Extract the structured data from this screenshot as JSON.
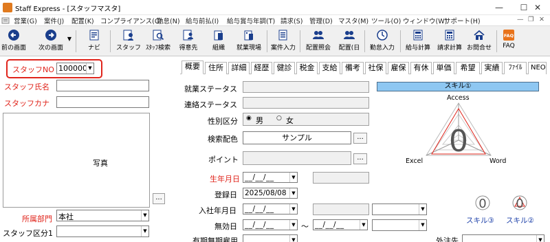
{
  "window": {
    "title": "Staff Express - [スタッフマスタ]"
  },
  "menu": [
    "営業(G)",
    "案件(J)",
    "配置(K)",
    "コンプライアンス(C)",
    "勤怠(N)",
    "給与前払(I)",
    "給与賞与年調(T)",
    "請求(S)",
    "管理(D)",
    "マスタ(M)",
    "ツール(O)",
    "ウィンドウ(W)",
    "サポート(H)"
  ],
  "toolbar": {
    "prev": "前の画面",
    "next": "次の画面",
    "navi": "ナビ",
    "staff": "スタッフ",
    "staff_search": "ｽﾀｯﾌ検索",
    "client": "得意先",
    "org": "組織",
    "site": "就業現場",
    "case_input": "案件入力",
    "assign_query": "配置照会",
    "assign_day": "配置(日",
    "attendance_input": "勤怠入力",
    "pay_calc": "給与計算",
    "bill_calc": "請求計算",
    "inquiry": "お問合せ",
    "faq": "FAQ"
  },
  "left": {
    "staff_no_label": "スタッフNO",
    "staff_no_value": "100000",
    "staff_name_label": "スタッフ氏名",
    "staff_kana_label": "スタッフカナ",
    "photo_label": "写真",
    "photo_btn": "...",
    "dept_label": "所属部門",
    "dept_value": "本社",
    "category_label": "スタッフ区分1"
  },
  "tabs": [
    "概要",
    "住所",
    "詳細",
    "経歴",
    "健診",
    "税金",
    "支給",
    "備考",
    "社保",
    "雇保",
    "有休",
    "単価",
    "希望",
    "実績",
    "ﾌｧｲﾙ",
    "NEO"
  ],
  "form": {
    "employment_status": "就業ステータス",
    "contact_status": "連絡ステータス",
    "gender_label": "性別区分",
    "gender_male": "男",
    "gender_female": "女",
    "search_color_label": "検索配色",
    "search_color_value": "サンプル",
    "point_label": "ポイント",
    "birth_label": "生年月日",
    "registered_label": "登録日",
    "registered_value": "2025/08/08",
    "hire_label": "入社年月日",
    "invalid_label": "無効日",
    "tilde": "～",
    "fixed_term_label": "有期無期雇用",
    "dispatch_label": "外注先",
    "date_blank": "__/__/__",
    "ellipsis": "..."
  },
  "skill": {
    "header": "スキル①",
    "axis_top": "Access",
    "axis_left": "Excel",
    "axis_right": "Word",
    "center_value": "0",
    "small3_label": "スキル③",
    "small2_label": "スキル②",
    "small_value": "0"
  }
}
